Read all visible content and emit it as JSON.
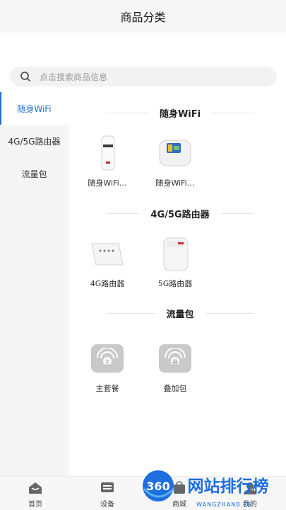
{
  "header": {
    "title": "商品分类"
  },
  "search": {
    "placeholder": "点击搜索商品信息",
    "icon": "search-icon"
  },
  "sidebar": {
    "items": [
      {
        "label": "随身WiFi",
        "active": true
      },
      {
        "label": "4G/5G路由器",
        "active": false
      },
      {
        "label": "流量包",
        "active": false
      }
    ]
  },
  "sections": [
    {
      "title": "随身WiFi",
      "products": [
        {
          "label": "随身WiFi…"
        },
        {
          "label": "随身WiFi…"
        }
      ]
    },
    {
      "title": "4G/5G路由器",
      "products": [
        {
          "label": "4G路由器"
        },
        {
          "label": "5G路由器"
        }
      ]
    },
    {
      "title": "流量包",
      "products": [
        {
          "label": "主套餐",
          "badge": "主"
        },
        {
          "label": "叠加包",
          "badge": "叠"
        }
      ]
    }
  ],
  "tabbar": {
    "tabs": [
      {
        "label": "首页",
        "icon": "home-icon"
      },
      {
        "label": "设备",
        "icon": "device-icon"
      },
      {
        "label": "商城",
        "icon": "shop-icon"
      },
      {
        "label": "我的",
        "icon": "user-icon"
      }
    ]
  },
  "watermark": {
    "brand_number": "360",
    "brand_text": "网站排行榜",
    "url": "WANGZHANB.CN"
  },
  "colors": {
    "accent": "#1f6fd0",
    "sidebar_bg": "#f5f5f5",
    "watermark_blue": "#1d6fe0"
  }
}
